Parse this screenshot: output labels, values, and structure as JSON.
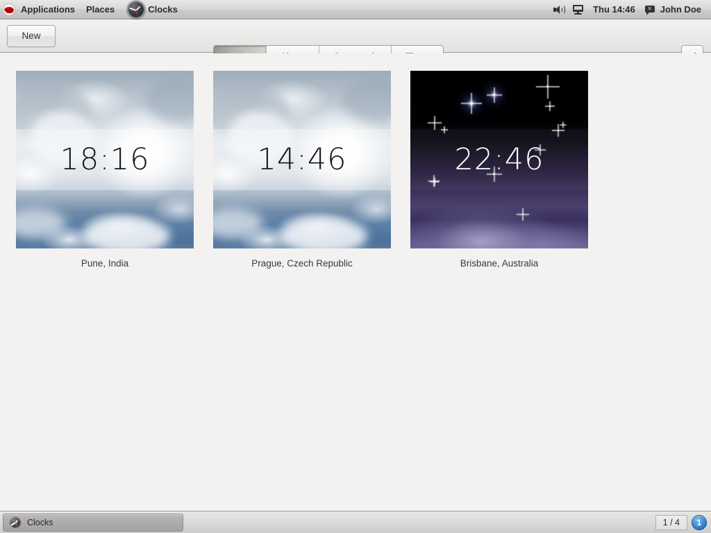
{
  "desktop": {
    "top_panel": {
      "logo_icon": "redhat-logo-icon",
      "applications_label": "Applications",
      "places_label": "Places",
      "window_title": "Clocks",
      "window_icon": "clock-icon",
      "volume_icon": "volume-icon",
      "display_icon": "display-icon",
      "clock_text": "Thu 14:46",
      "chat_icon": "chat-icon",
      "user_name": "John Doe"
    },
    "bottom_panel": {
      "taskbar_window_label": "Clocks",
      "taskbar_window_icon": "clock-icon",
      "workspace_indicator": "1 / 4",
      "notification_count": "1"
    }
  },
  "app": {
    "toolbar": {
      "new_label": "New",
      "confirm_icon": "checkmark-icon",
      "tabs": [
        {
          "label": "World",
          "active": true
        },
        {
          "label": "Alarm",
          "active": false
        },
        {
          "label": "Stopwatch",
          "active": false
        },
        {
          "label": "Timer",
          "active": false
        }
      ]
    },
    "world_clocks": [
      {
        "time": "18:16",
        "location": "Pune, India",
        "daylight": "day"
      },
      {
        "time": "14:46",
        "location": "Prague, Czech Republic",
        "daylight": "day"
      },
      {
        "time": "22:46",
        "location": "Brisbane, Australia",
        "daylight": "night"
      }
    ]
  },
  "colors": {
    "panel_bg": "#d5d3d1",
    "content_bg": "#f3f2f1",
    "active_tab_text": "#f4f4f3",
    "notification_blue": "#3a87d2"
  }
}
